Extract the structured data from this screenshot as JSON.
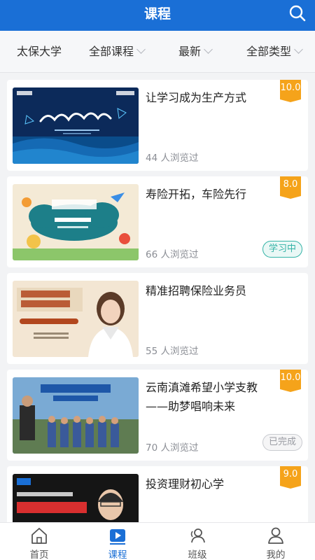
{
  "header": {
    "title": "课程",
    "search_icon": "search-icon"
  },
  "filters": [
    {
      "label": "太保大学",
      "has_chevron": false
    },
    {
      "label": "全部课程",
      "has_chevron": true
    },
    {
      "label": "最新",
      "has_chevron": true
    },
    {
      "label": "全部类型",
      "has_chevron": true
    }
  ],
  "courses": [
    {
      "title": "让学习成为生产方式",
      "views": "44 人浏览过",
      "score": "10.0",
      "badge": "",
      "thumb": "thumb-lecture-stage"
    },
    {
      "title": "寿险开拓，车险先行",
      "views": "66 人浏览过",
      "score": "8.0",
      "badge": "学习中",
      "thumb": "thumb-cartoon-cloud"
    },
    {
      "title": "精准招聘保险业务员",
      "views": "55 人浏览过",
      "score": "",
      "badge": "",
      "thumb": "thumb-speaker-woman"
    },
    {
      "title": "云南滇滩希望小学支教——助梦唱响未来",
      "views": "70 人浏览过",
      "score": "10.0",
      "badge": "已完成",
      "thumb": "thumb-children-school"
    },
    {
      "title": "投资理财初心学",
      "views": "",
      "score": "9.0",
      "badge": "",
      "thumb": "thumb-finance-analyst"
    }
  ],
  "tabs": [
    {
      "label": "首页",
      "icon": "home-icon",
      "active": false
    },
    {
      "label": "课程",
      "icon": "play-video-icon",
      "active": true
    },
    {
      "label": "班级",
      "icon": "class-group-icon",
      "active": false
    },
    {
      "label": "我的",
      "icon": "user-profile-icon",
      "active": false
    }
  ],
  "colors": {
    "primary": "#1a6fd6",
    "score": "#f5a31a",
    "learning": "#33b3a6",
    "done": "#9a9ca3"
  }
}
